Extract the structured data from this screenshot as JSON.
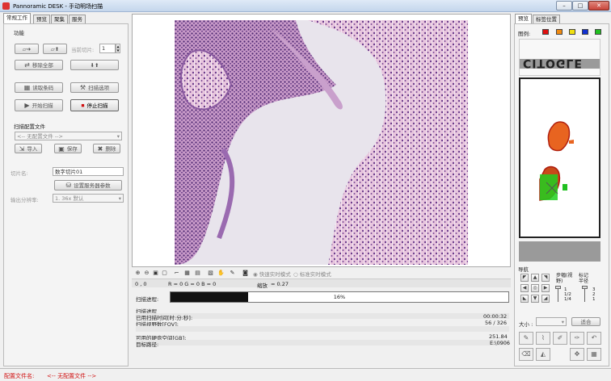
{
  "window": {
    "title": "Pannoramic DESK - 手动明场扫描",
    "minimize": "–",
    "maximize": "□",
    "close": "✕",
    "close_color": "#c9453a"
  },
  "left_tabs": [
    "常规工作",
    "预览",
    "聚集",
    "服务"
  ],
  "functions": {
    "header": "功能",
    "current_slide_label": "当前切片:",
    "current_slide_value": "1",
    "remove_all": "移除全部",
    "read_barcode": "读取条码",
    "scan_options": "扫描选项",
    "start_scan": "开始扫描",
    "stop_scan": "停止扫描"
  },
  "scan_config": {
    "header": "扫描配置文件",
    "select_value": "<-- 无配置文件 -->",
    "import": "导入",
    "save": "保存",
    "delete": "删除"
  },
  "slide": {
    "name_label": "切片名:",
    "name_value": "数字切片01",
    "server_params": "设置服务器参数",
    "resolution_label": "输出分辨率:",
    "resolution_value": "1. 36x 默认"
  },
  "viewer": {
    "live_mode_fast": "快速实时模式",
    "live_mode_standard": "标准实时模式",
    "coords": "0 , 0",
    "rgb": "R = 0  G = 0  B = 0",
    "zoom_label": "缩放",
    "zoom_value": "= 0.27"
  },
  "progress": {
    "label": "扫描进程:",
    "percent_text": "16%",
    "fraction": 0.23
  },
  "scan_info": {
    "title": "扫描进程",
    "elapsed_label": "已用扫描时间[时:分:秒]:",
    "elapsed_value": "00:00:32",
    "fov_label": "扫描视野数[FOV]:",
    "fov_value": "56 / 326",
    "disk_label": "可用的硬盘空间[GB]:",
    "disk_value": "251.84",
    "path_label": "目标路径:",
    "path_value": "E:\\0906"
  },
  "right_tabs": [
    "预览",
    "标签位置"
  ],
  "legend": {
    "label": "图例:",
    "colors": [
      "#e01010",
      "#f08a10",
      "#f0e010",
      "#1030d0",
      "#20c020"
    ]
  },
  "slide_label_text": "CITOGLE",
  "navigation": {
    "header": "导航",
    "step_label": "步幅(视野)",
    "marker_label": "标记半径",
    "step_values": [
      "1",
      "1/2",
      "1/4"
    ],
    "marker_values": [
      "3",
      "2",
      "1"
    ],
    "size_label": "大小 :",
    "fit_label": "适合"
  },
  "status": {
    "config_label": "配置文件名:",
    "config_value": "<-- 无配置文件 -->"
  }
}
